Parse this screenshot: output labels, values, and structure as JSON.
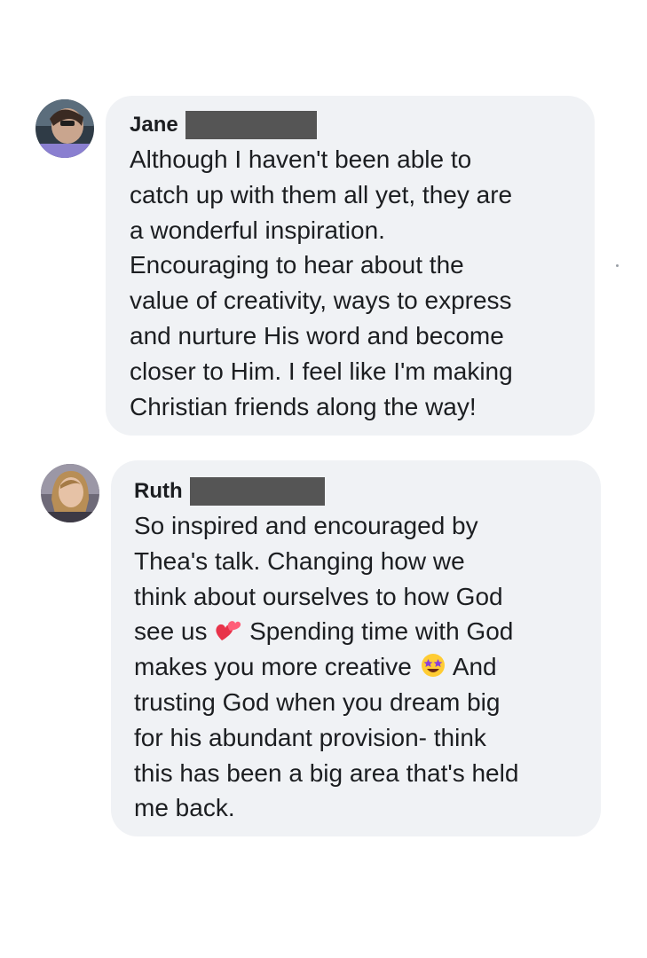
{
  "comments": [
    {
      "author": "Jane",
      "text_lines": [
        "Although I haven't been able to",
        "catch up with them all yet, they are",
        "a wonderful inspiration.",
        "Encouraging to hear about the",
        "value of creativity, ways to express",
        "and nurture His word and become",
        "closer to Him. I feel like I'm making",
        "Christian friends along the way!"
      ]
    },
    {
      "author": "Ruth",
      "text_lines": {
        "l1": "So inspired and encouraged by",
        "l2": "Thea's talk. Changing how we",
        "l3": "think about ourselves to how God",
        "l4a": "see us",
        "l4b": "Spending time with God",
        "l5a": "makes you more creative",
        "l5b": "And",
        "l6": "trusting God when you dream big",
        "l7": "for his abundant provision- think",
        "l8": "this has been a big area that's held",
        "l9": "me back."
      },
      "emojis": [
        "two-hearts-icon",
        "star-struck-icon"
      ]
    }
  ]
}
